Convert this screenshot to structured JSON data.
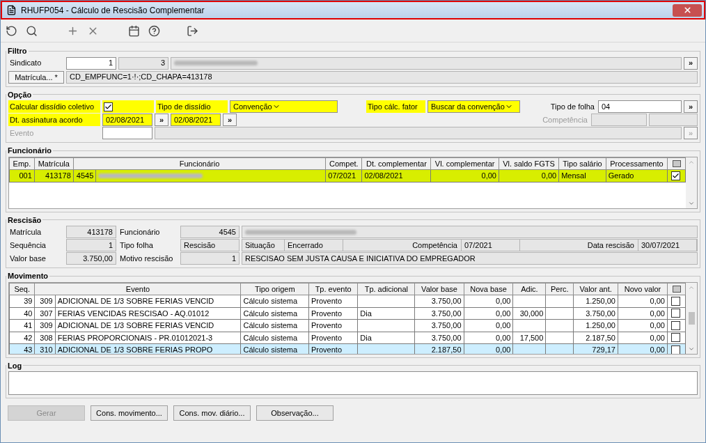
{
  "window": {
    "title": "RHUFP054 - Cálculo de Rescisão Complementar"
  },
  "filtro": {
    "title": "Filtro",
    "sindicato_label": "Sindicato",
    "sindicato_code": "1",
    "sindicato_number": "3",
    "sindicato_name_redacted": true,
    "lookup_button": "»",
    "matricula_button": "Matrícula... *",
    "matricula_value": "CD_EMPFUNC=1·!·;CD_CHAPA=413178"
  },
  "opcao": {
    "title": "Opção",
    "calcular": {
      "label": "Calcular dissídio coletivo",
      "highlighted": true,
      "checked": true
    },
    "tipo_dissidio": {
      "label": "Tipo de dissídio",
      "value": "Convenção",
      "highlighted": true
    },
    "tipo_calc": {
      "label": "Tipo cálc. fator",
      "value": "Buscar da convenção",
      "highlighted": true
    },
    "tipo_folha": {
      "label": "Tipo de folha",
      "value": "04",
      "button": "»"
    },
    "dt_assinatura": {
      "label": "Dt. assinatura acordo",
      "highlighted": true,
      "value_from": "02/08/2021",
      "button_from": "»",
      "value_to": "02/08/2021",
      "button_to": "»"
    },
    "competencia": {
      "label": "Competência",
      "disabled": true
    },
    "evento": {
      "label": "Evento",
      "disabled": true,
      "button": "»"
    }
  },
  "funcionario": {
    "title": "Funcionário",
    "columns": [
      "Emp.",
      "Matrícula",
      "Funcionário",
      "Compet.",
      "Dt. complementar",
      "Vl. complementar",
      "Vl. saldo FGTS",
      "Tipo salário",
      "Processamento"
    ],
    "rows": [
      {
        "emp": "001",
        "matricula": "413178",
        "codigo": "4545",
        "name_redacted": true,
        "compet": "07/2021",
        "dt_complementar": "02/08/2021",
        "vl_complementar": "0,00",
        "vl_saldo_fgts": "0,00",
        "tipo_salario": "Mensal",
        "processamento": "Gerado",
        "checked": true,
        "selected": true
      }
    ]
  },
  "rescisao": {
    "title": "Rescisão",
    "matricula_label": "Matrícula",
    "matricula": "413178",
    "funcionario_label": "Funcionário",
    "funcionario": "4545",
    "name_redacted": true,
    "sequencia_label": "Sequência",
    "sequencia": "1",
    "tipo_folha_label": "Tipo folha",
    "tipo_folha": "Rescisão",
    "situacao_label": "Situação",
    "situacao": "Encerrado",
    "competencia_label": "Competência",
    "competencia": "07/2021",
    "data_label": "Data rescisão",
    "data": "30/07/2021",
    "valor_base_label": "Valor base",
    "valor_base": "3.750,00",
    "motivo_label": "Motivo rescisão",
    "motivo_code": "1",
    "motivo": "RESCISAO SEM JUSTA CAUSA E INICIATIVA DO EMPREGADOR"
  },
  "movimento": {
    "title": "Movimento",
    "columns": [
      "Seq.",
      "Evento",
      "Tipo origem",
      "Tp. evento",
      "Tp. adicional",
      "Valor base",
      "Nova base",
      "Adic.",
      "Perc.",
      "Valor ant.",
      "Novo valor"
    ],
    "rows": [
      {
        "seq": "39",
        "codigo": "309",
        "evento": "ADICIONAL DE 1/3 SOBRE FERIAS VENCID",
        "tipo_origem": "Cálculo sistema",
        "tp_evento": "Provento",
        "valor_base": "3.750,00",
        "nova_base": "0,00",
        "valor_ant": "1.250,00",
        "novo_valor": "0,00",
        "checked": false,
        "selected": false
      },
      {
        "seq": "40",
        "codigo": "307",
        "evento": "FERIAS VENCIDAS RESCISAO - AQ.01012",
        "tipo_origem": "Cálculo sistema",
        "tp_evento": "Provento",
        "tp_adicional": "Dia",
        "valor_base": "3.750,00",
        "nova_base": "0,00",
        "adic": "30,000",
        "valor_ant": "3.750,00",
        "novo_valor": "0,00",
        "checked": false,
        "selected": false
      },
      {
        "seq": "41",
        "codigo": "309",
        "evento": "ADICIONAL DE 1/3 SOBRE FERIAS VENCID",
        "tipo_origem": "Cálculo sistema",
        "tp_evento": "Provento",
        "valor_base": "3.750,00",
        "nova_base": "0,00",
        "valor_ant": "1.250,00",
        "novo_valor": "0,00",
        "checked": false,
        "selected": false
      },
      {
        "seq": "42",
        "codigo": "308",
        "evento": "FERIAS PROPORCIONAIS - PR.01012021-3",
        "tipo_origem": "Cálculo sistema",
        "tp_evento": "Provento",
        "tp_adicional": "Dia",
        "valor_base": "3.750,00",
        "nova_base": "0,00",
        "adic": "17,500",
        "valor_ant": "2.187,50",
        "novo_valor": "0,00",
        "checked": false,
        "selected": false
      },
      {
        "seq": "43",
        "codigo": "310",
        "evento": "ADICIONAL DE 1/3 SOBRE FERIAS PROPO",
        "tipo_origem": "Cálculo sistema",
        "tp_evento": "Provento",
        "valor_base": "2.187,50",
        "nova_base": "0,00",
        "valor_ant": "729,17",
        "novo_valor": "0,00",
        "checked": false,
        "selected": true
      }
    ]
  },
  "log": {
    "title": "Log"
  },
  "buttons": [
    {
      "label": "Gerar",
      "disabled": true
    },
    {
      "label": "Cons. movimento...",
      "disabled": false
    },
    {
      "label": "Cons. mov. diário...",
      "disabled": false
    },
    {
      "label": "Observação...",
      "disabled": false
    }
  ]
}
